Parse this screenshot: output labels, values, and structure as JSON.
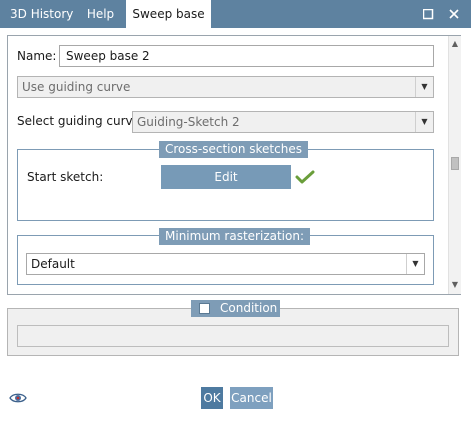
{
  "tabs": [
    {
      "label": "3D History",
      "active": false
    },
    {
      "label": "Help",
      "active": false
    },
    {
      "label": "Sweep base",
      "active": true
    }
  ],
  "window_controls": {
    "restore_icon": "restore-icon",
    "close_icon": "close-icon"
  },
  "form": {
    "name_label": "Name:",
    "name_value": "Sweep base 2",
    "mode_select": {
      "value": "Use guiding curve",
      "enabled": false
    },
    "guiding_curve_label": "Select guiding curve:",
    "guiding_curve_select": {
      "value": "Guiding-Sketch 2",
      "enabled": false
    },
    "cross_section": {
      "title": "Cross-section sketches",
      "start_sketch_label": "Start sketch:",
      "edit_button": "Edit",
      "status_icon": "checkmark-icon"
    },
    "min_rasterization": {
      "title": "Minimum rasterization:",
      "select_value": "Default"
    }
  },
  "condition": {
    "label": "Condition",
    "checked": false,
    "value": ""
  },
  "footer": {
    "ok_label": "OK",
    "cancel_label": "Cancel",
    "eye_icon": "eye-icon"
  },
  "colors": {
    "titlebar": "#5e82a0",
    "group_title": "#7e9cb6",
    "button": "#779ab7",
    "accent_check": "#6a9e3a"
  }
}
